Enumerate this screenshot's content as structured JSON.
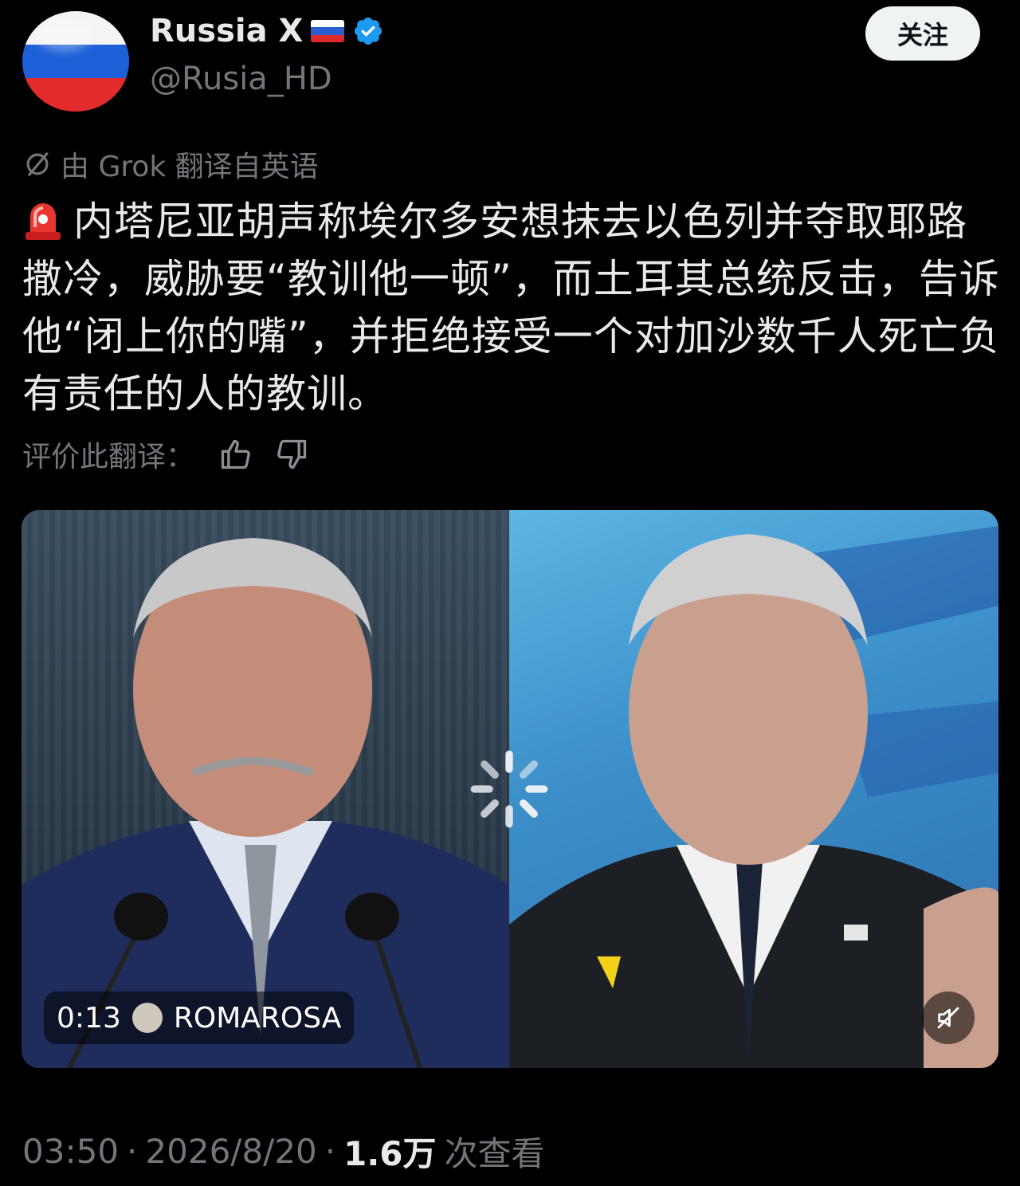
{
  "author": {
    "name": "Russia X",
    "handle": "@Rusia_HD"
  },
  "follow_label": "关注",
  "translation_note": "由 Grok 翻译自英语",
  "tweet": {
    "text": "内塔尼亚胡声称埃尔多安想抹去以色列并夺取耶路撒冷，威胁要“教训他一顿”，而土耳其总统反击，告诉他“闭上你的嘴”，并拒绝接受一个对加沙数千人死亡负有责任的人的教训。"
  },
  "rate_translation_label": "评价此翻译：",
  "media": {
    "duration": "0:13",
    "watermark": "ROMAROSA"
  },
  "meta": {
    "time": "03:50",
    "date": "2026/8/20",
    "views": "1.6万",
    "views_label": "次查看"
  },
  "colors": {
    "background": "#000000",
    "text": "#e7e9ea",
    "muted": "#71767b",
    "verified": "#1d9bf0",
    "follow_bg": "#eff3f4"
  },
  "icons": [
    "russia-flag-avatar",
    "russia-flag-icon",
    "verified-badge-icon",
    "grok-icon",
    "alarm-emoji-icon",
    "thumbs-up-icon",
    "thumbs-down-icon",
    "loading-spinner-icon",
    "mute-icon"
  ]
}
